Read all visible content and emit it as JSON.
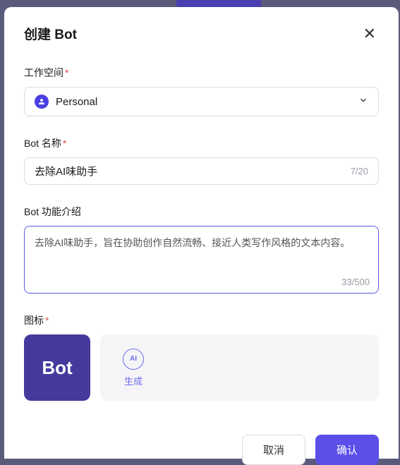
{
  "modal": {
    "title": "创建 Bot"
  },
  "workspace": {
    "label": "工作空间",
    "value": "Personal"
  },
  "botName": {
    "label": "Bot 名称",
    "value": "去除AI味助手",
    "counter": "7/20"
  },
  "description": {
    "label": "Bot 功能介绍",
    "value": "去除AI味助手，旨在协助创作自然流畅、接近人类写作风格的文本内容。",
    "counter": "33/500"
  },
  "icon": {
    "label": "图标",
    "avatarText": "Bot",
    "generateLabel": "生成",
    "generateIconText": "AI"
  },
  "footer": {
    "cancel": "取消",
    "confirm": "确认"
  }
}
